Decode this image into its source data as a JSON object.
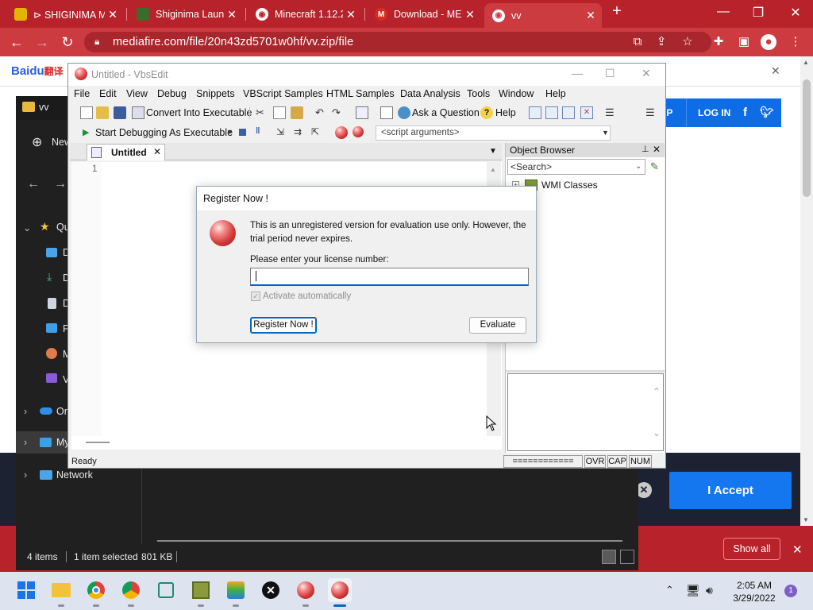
{
  "browser": {
    "tabs": [
      {
        "title": "⊳ SHIGINIMA M",
        "favicon_color": "#e4b400"
      },
      {
        "title": "Shiginima Laun",
        "favicon_color": "#3d6b2b"
      },
      {
        "title": "Minecraft 1.12.2",
        "favicon_color": "#ffffff"
      },
      {
        "title": "Download - ME",
        "favicon_color": "#d62d20"
      },
      {
        "title": "vv",
        "favicon_color": "#ffffff"
      }
    ],
    "url": "mediafire.com/file/20n43zd5701w0hf/vv.zip/file",
    "accent_color": "#b8222b"
  },
  "webpage": {
    "baidu_logo": "Bai",
    "baidu_logo_b": "du",
    "baidu_logo_c": "翻译",
    "signup_fragment": "IP",
    "login_label": "LOG IN",
    "accept_label": "I Accept",
    "show_all_label": "Show all"
  },
  "explorer": {
    "title": "vv",
    "new_label": "New",
    "quick_label": "Qu",
    "onedrive_label": "On",
    "mypc_label": "My",
    "network_label": "Network",
    "status_items": "4 items",
    "status_selected": "1 item selected",
    "status_size": "801 KB",
    "sidebar_letters": [
      "D",
      "D",
      "D",
      "P",
      "M",
      "V"
    ]
  },
  "vbsedit": {
    "title": "Untitled - VbsEdit",
    "menu": [
      "File",
      "Edit",
      "View",
      "Debug",
      "Snippets",
      "VBScript Samples",
      "HTML Samples",
      "Data Analysis",
      "Tools",
      "Window",
      "Help"
    ],
    "toolbar": {
      "convert_label": "Convert Into Executable",
      "ask_label": "Ask a Question",
      "help_label": "Help",
      "debug_label": "Start Debugging As Executable",
      "args_placeholder": "<script arguments>"
    },
    "doc_tab": "Untitled",
    "line_number": "1",
    "object_browser": {
      "title": "Object Browser",
      "search_placeholder": "<Search>",
      "tree_item": "WMI Classes"
    },
    "status": {
      "ready": "Ready",
      "progress": "============",
      "ovr": "OVR",
      "cap": "CAP",
      "num": "NUM"
    }
  },
  "dialog": {
    "title": "Register Now !",
    "message": "This is an unregistered version for evaluation use only. However, the trial period never expires.",
    "license_label": "Please enter your license number:",
    "license_value": "",
    "activate_label": "Activate automatically",
    "register_button": "Register Now !",
    "evaluate_button": "Evaluate"
  },
  "taskbar": {
    "time": "2:05 AM",
    "date": "3/29/2022",
    "notification_count": "1"
  }
}
